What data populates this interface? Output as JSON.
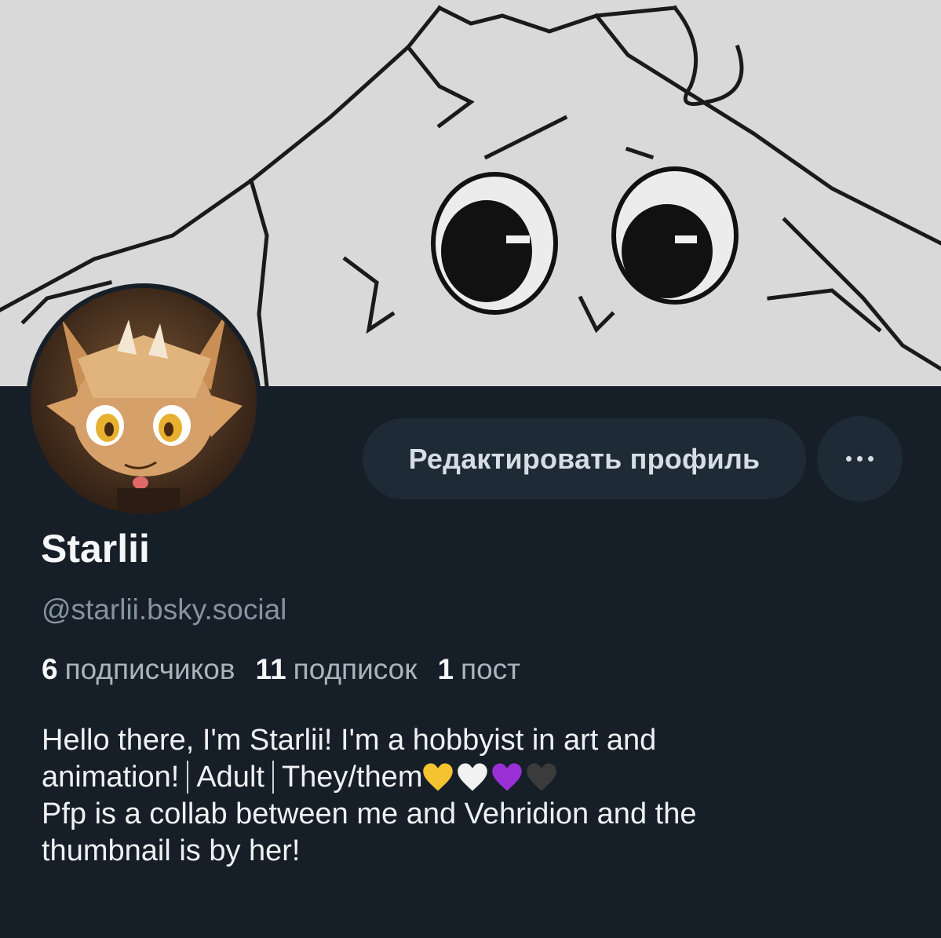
{
  "profile": {
    "display_name": "Starlii",
    "handle": "@starlii.bsky.social",
    "edit_button_label": "Редактировать профиль",
    "more_button_icon": "more-horizontal-icon"
  },
  "stats": {
    "followers_count": "6",
    "followers_label": "подписчиков",
    "following_count": "11",
    "following_label": "подписок",
    "posts_count": "1",
    "posts_label": "пост"
  },
  "bio": {
    "line1": "Hello there, I'm Starlii! I'm a hobbyist in art and",
    "line2_part1": "animation!",
    "line2_part2": "Adult",
    "line2_part3": "They/them",
    "hearts": [
      "#f4c430",
      "#f2f2f2",
      "#9b2fd6",
      "#3b3b3b"
    ],
    "line3": "Pfp is a collab between me and Vehridion and the",
    "line4": "thumbnail is by her!"
  },
  "colors": {
    "background": "#161e27",
    "button_bg": "#1e2a36",
    "muted_text": "#8693a1"
  }
}
